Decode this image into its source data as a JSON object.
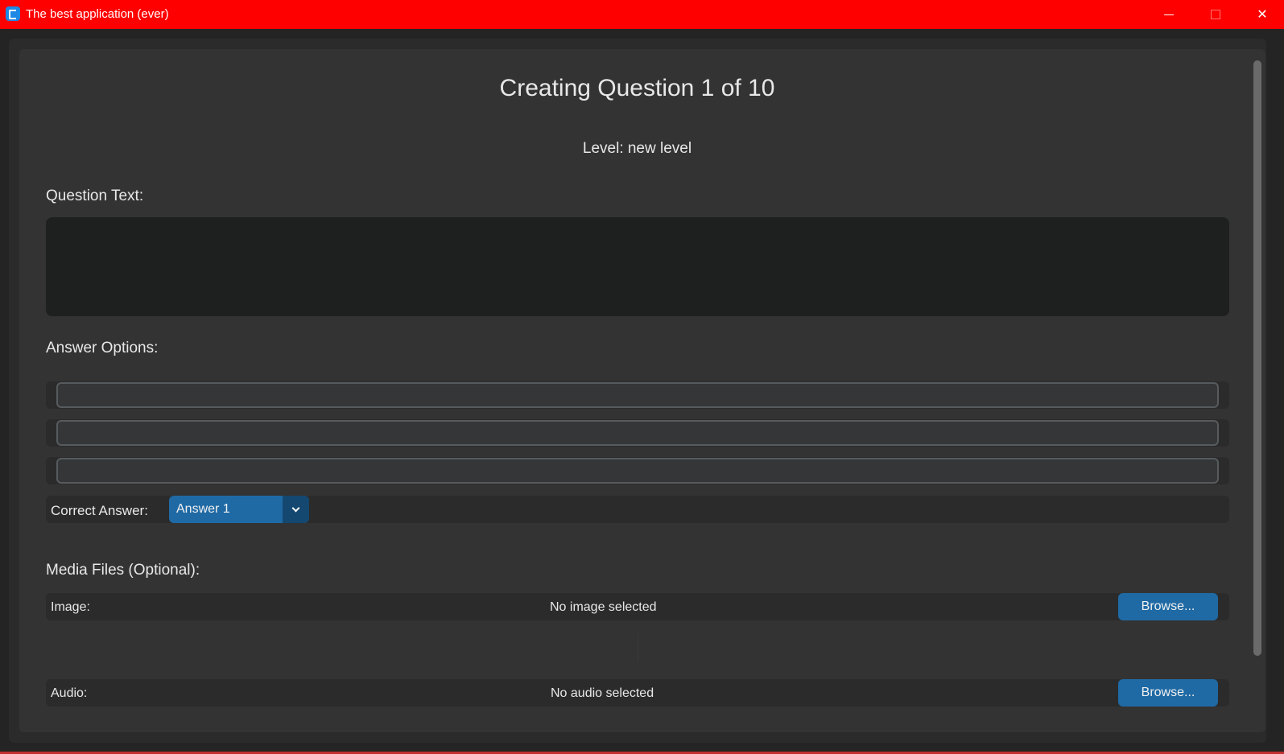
{
  "window": {
    "title": "The best application (ever)",
    "minimize_icon": "minimize-icon",
    "maximize_icon": "maximize-icon",
    "close_icon": "close-icon",
    "accent_color": "#ff0000"
  },
  "header": {
    "title": "Creating Question 1 of 10",
    "level": "Level: new level"
  },
  "question": {
    "label": "Question Text:",
    "value": ""
  },
  "answers": {
    "label": "Answer Options:",
    "options": [
      "",
      "",
      ""
    ],
    "correct_label": "Correct Answer:",
    "correct_value": "Answer 1"
  },
  "media": {
    "label": "Media Files (Optional):",
    "image_label": "Image:",
    "image_status": "No image selected",
    "audio_label": "Audio:",
    "audio_status": "No audio selected",
    "browse_label": "Browse..."
  },
  "colors": {
    "button": "#1f6aa5",
    "panel": "#333333",
    "input_bg": "#1e1f1f"
  }
}
